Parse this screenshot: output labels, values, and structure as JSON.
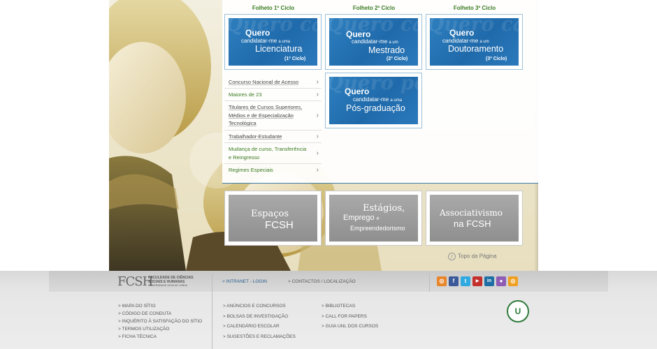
{
  "folhetos": [
    "Folheto 1º Ciclo",
    "Folheto 2º Ciclo",
    "Folheto 3º Ciclo"
  ],
  "banners": [
    {
      "quero": "Quero",
      "candidatar": "candidatar-me",
      "article": "a uma",
      "main": "Licenciatura",
      "cycle": "(1º Ciclo)",
      "bg": "Quero candidatar"
    },
    {
      "quero": "Quero",
      "candidatar": "candidatar-me",
      "article": "a um",
      "main": "Mestrado",
      "cycle": "(2º Ciclo)",
      "bg": "Quero candidatar Mestrado"
    },
    {
      "quero": "Quero",
      "candidatar": "candidatar-me",
      "article": "a um",
      "main": "Doutoramento",
      "cycle": "(3º Ciclo)",
      "bg": "Quero candidatar Doutoramento"
    },
    {
      "quero": "Quero",
      "candidatar": "candidatar-me",
      "article": "a uma",
      "main": "Pós-graduação",
      "cycle": "",
      "bg": "Quero pós-graduação"
    }
  ],
  "menu": [
    {
      "label": "Concurso Nacional de Acesso",
      "style": "dark"
    },
    {
      "label": "Maiores de 23",
      "style": "green"
    },
    {
      "label": "Titulares de Cursos Superiores, Médios e de Especialização Tecnológica",
      "style": "dark"
    },
    {
      "label": "Trabalhador-Estudante",
      "style": "dark"
    },
    {
      "label": "Mudança de curso, Transferência e Reingresso",
      "style": "green"
    },
    {
      "label": "Regimes Especiais",
      "style": "green"
    }
  ],
  "gray_banners": {
    "espacos": {
      "line1": "Espaços",
      "line2": "FCSH"
    },
    "estagios": {
      "line1": "Estágios,",
      "line2": "Emprego",
      "conj": "e",
      "line3": "Empreendedorismo"
    },
    "associativismo": {
      "line1": "Associativismo",
      "line2": "na FCSH"
    }
  },
  "topo": "Topo da Página",
  "footer": {
    "logo_mark": "FCSH",
    "logo_text": [
      "FACULDADE DE CIÊNCIAS",
      "SOCIAIS E HUMANAS",
      "UNIVERSIDADE NOVA DE LISBOA"
    ],
    "intranet": "> INTRANET - LOGIN",
    "contactos": "> CONTACTOS / LOCALIZAÇÃO",
    "col1": [
      "> MAPA DO SÍTIO",
      "> CÓDIGO DE CONDUTA",
      "> INQUÉRITO À SATISFAÇÃO DO SÍTIO",
      "> TERMOS UTILIZAÇÃO",
      "> FICHA TÉCNICA"
    ],
    "col2": [
      "> ANÚNCIOS E CONCURSOS",
      "> BOLSAS DE INVESTIGAÇÃO",
      "> CALENDÁRIO ESCOLAR",
      "> SUGESTÕES E RECLAMAÇÕES"
    ],
    "col3": [
      "> BIBLIOTECAS",
      "> CALL FOR PAPERS",
      "> GUIA UNL DOS CURSOS"
    ],
    "social": [
      {
        "name": "rss-icon",
        "glyph": "◎",
        "color": "#e8862a"
      },
      {
        "name": "facebook-icon",
        "glyph": "f",
        "color": "#3b5998"
      },
      {
        "name": "twitter-icon",
        "glyph": "t",
        "color": "#2fa9e0"
      },
      {
        "name": "youtube-icon",
        "glyph": "▶",
        "color": "#c4302b"
      },
      {
        "name": "linkedin-icon",
        "glyph": "in",
        "color": "#1c6ea4"
      },
      {
        "name": "flickr-icon",
        "glyph": "●",
        "color": "#8e5bb5"
      },
      {
        "name": "feed-icon",
        "glyph": "◎",
        "color": "#f0a020"
      }
    ],
    "seal": "U"
  }
}
